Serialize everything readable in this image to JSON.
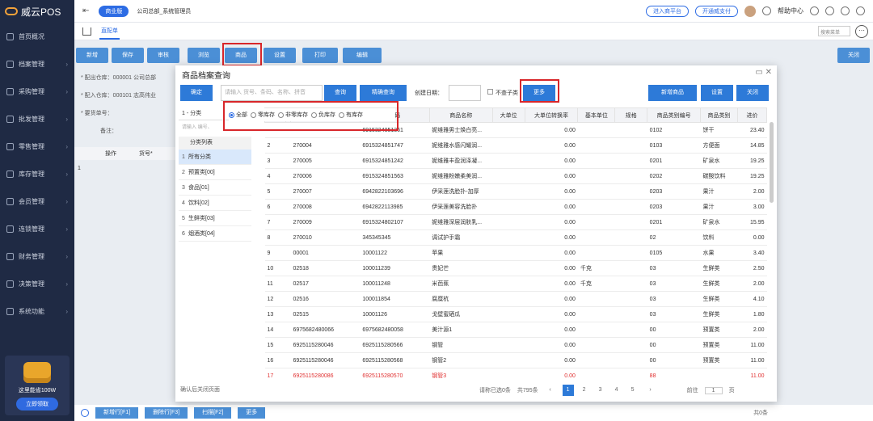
{
  "app": {
    "name": "威云POS"
  },
  "sidebar": {
    "items": [
      "首页概况",
      "档案管理",
      "采购管理",
      "批发管理",
      "零售管理",
      "库存管理",
      "会员管理",
      "连锁管理",
      "财务管理",
      "决策管理",
      "系统功能"
    ],
    "promo_text": "这里能省100W",
    "promo_button": "立即领取"
  },
  "topbar": {
    "collapse_icon": "menu-fold-icon",
    "biz_badge": "商业版",
    "company": "公司总部_系统管理员",
    "enter_platform": "进入商平台",
    "open_pay": "开通威支付",
    "help": "帮助中心"
  },
  "tabs": {
    "active": "直配单",
    "search_menu": "搜索菜单"
  },
  "toolbar": {
    "buttons": [
      "新增",
      "保存",
      "审核",
      "浏览",
      "商品",
      "设置",
      "打印",
      "编辑"
    ],
    "close": "关闭"
  },
  "bgform": {
    "out_warehouse": "* 配出仓库：",
    "out_value": "000001 公司总部",
    "in_warehouse": "* 配入仓库：",
    "in_value": "000101 志高伟业",
    "req_no": "* 要货单号：",
    "remark": "备注：",
    "col_op": "操作",
    "col_no": "货号*",
    "row1": "1"
  },
  "bottom": {
    "buttons": [
      "新增行[F1]",
      "删除行[F3]",
      "扫描[F2]",
      "更多"
    ],
    "page_summary": "共0条"
  },
  "modal": {
    "title": "商品档案查询",
    "confirm": "确定",
    "search_placeholder": "请输入 货号、条码、名称、拼音",
    "query": "查询",
    "precise_query": "精确查询",
    "create_date": "创建日期：",
    "no_children": "不查子类",
    "more": "更多",
    "add_product": "新增商品",
    "settings": "设置",
    "close": "关闭",
    "category_head": "1 - 分类",
    "category_input": "请输入 编号、",
    "category_list_title": "分类列表",
    "categories": [
      {
        "n": "1",
        "name": "所有分类"
      },
      {
        "n": "2",
        "name": "预置类[00]"
      },
      {
        "n": "3",
        "name": "食品[01]"
      },
      {
        "n": "4",
        "name": "饮料[02]"
      },
      {
        "n": "5",
        "name": "生鲜类[03]"
      },
      {
        "n": "6",
        "name": "烟酒类[04]"
      }
    ],
    "radios": [
      "全部",
      "零库存",
      "非零库存",
      "负库存",
      "有库存"
    ],
    "columns": [
      "",
      "",
      "货号",
      "条码",
      "商品名称",
      "大单位",
      "大单位转换率",
      "基本单位",
      "规格",
      "商品类别编号",
      "商品类别",
      "进价"
    ],
    "rows": [
      [
        "",
        "",
        "",
        "6915324851361",
        "妮维雅男士焕白亮...",
        "",
        "0.00",
        "",
        "",
        "0102",
        "饼干",
        "23.40"
      ],
      [
        "2",
        "",
        "270004",
        "6915324851747",
        "妮维雅水感闪耀润...",
        "",
        "0.00",
        "",
        "",
        "0103",
        "方便面",
        "14.85"
      ],
      [
        "3",
        "",
        "270005",
        "6915324851242",
        "妮维雅丰盈润泽凝...",
        "",
        "0.00",
        "",
        "",
        "0201",
        "矿泉水",
        "19.25"
      ],
      [
        "4",
        "",
        "270006",
        "6915324851563",
        "妮维雅粉嫩柔美润...",
        "",
        "0.00",
        "",
        "",
        "0202",
        "碳酸饮料",
        "19.25"
      ],
      [
        "5",
        "",
        "270007",
        "6942822103696",
        "伊采莲洗脸扑-加厚",
        "",
        "0.00",
        "",
        "",
        "0203",
        "果汁",
        "2.00"
      ],
      [
        "6",
        "",
        "270008",
        "6942822113985",
        "伊采莲美容洗脸扑",
        "",
        "0.00",
        "",
        "",
        "0203",
        "果汁",
        "3.00"
      ],
      [
        "7",
        "",
        "270009",
        "6915324802107",
        "妮维雅深层润肤乳...",
        "",
        "0.00",
        "",
        "",
        "0201",
        "矿泉水",
        "15.95"
      ],
      [
        "8",
        "",
        "270010",
        "345345345",
        "调试护手霜",
        "",
        "0.00",
        "",
        "",
        "02",
        "饮料",
        "0.00"
      ],
      [
        "9",
        "",
        "00001",
        "10001122",
        "苹果",
        "",
        "0.00",
        "",
        "",
        "0105",
        "水果",
        "3.40"
      ],
      [
        "10",
        "",
        "02518",
        "100011239",
        "贵妃芒",
        "",
        "0.00",
        "千克",
        "",
        "03",
        "生鲜类",
        "2.50"
      ],
      [
        "11",
        "",
        "02517",
        "100011248",
        "米芭蕉",
        "",
        "0.00",
        "千克",
        "",
        "03",
        "生鲜类",
        "2.00"
      ],
      [
        "12",
        "",
        "02516",
        "100011854",
        "腐糜杭",
        "",
        "0.00",
        "",
        "",
        "03",
        "生鲜类",
        "4.10"
      ],
      [
        "13",
        "",
        "02515",
        "10001126",
        "戈壁蜜硒瓜",
        "",
        "0.00",
        "",
        "",
        "03",
        "生鲜类",
        "1.80"
      ],
      [
        "14",
        "",
        "6975682480066",
        "6975682480058",
        "美汁源1",
        "",
        "0.00",
        "",
        "",
        "00",
        "预置类",
        "2.00"
      ],
      [
        "15",
        "",
        "6925115280046",
        "6925115280566",
        "钢管",
        "",
        "0.00",
        "",
        "",
        "00",
        "预置类",
        "11.00"
      ],
      [
        "16",
        "",
        "6925115280046",
        "6925115280568",
        "钢管2",
        "",
        "0.00",
        "",
        "",
        "00",
        "预置类",
        "11.00"
      ],
      [
        "17",
        "",
        "6925115280086",
        "6925115280570",
        "钢管3",
        "",
        "0.00",
        "",
        "",
        "88",
        "",
        "11.00"
      ]
    ],
    "confirm_close": "确认后关闭页面",
    "pager": {
      "selected": "请称已选0条",
      "total": "共795条",
      "pages": [
        "1",
        "2",
        "3",
        "4",
        "5"
      ],
      "goto": "前往",
      "page_val": "1",
      "page_unit": "页"
    }
  }
}
